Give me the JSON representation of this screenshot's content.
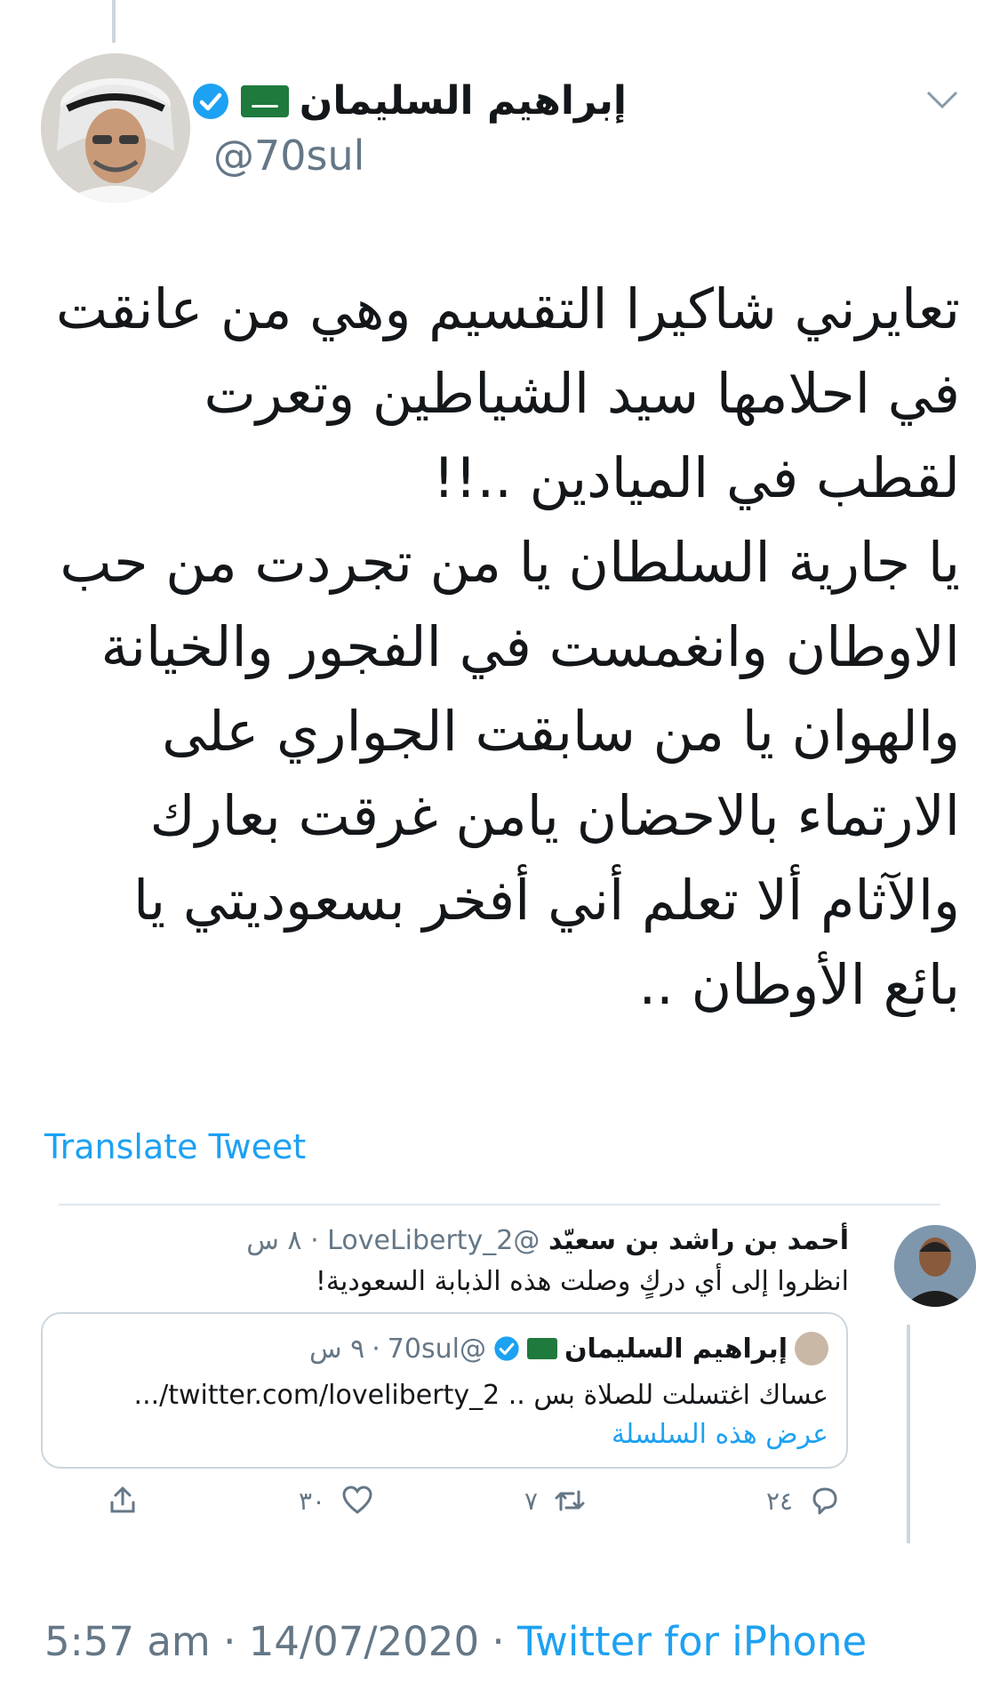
{
  "author": {
    "name": "إبراهيم السليمان",
    "handle": "@70sul"
  },
  "tweet": {
    "paragraphs": [
      "تعايرني شاكيرا التقسيم وهي من عانقت في احلامها سيد الشياطين وتعرت لقطب في الميادين ..!!",
      "يا جارية السلطان يا من تجردت من حب الاوطان وانغمست في الفجور والخيانة والهوان يا من سابقت الجواري على الارتماء بالاحضان يامن غرقت بعارك والآثام ألا تعلم أني أفخر بسعوديتي يا بائع الأوطان .."
    ],
    "translate_label": "Translate Tweet"
  },
  "reply": {
    "name": "أحمد بن راشد بن سعيّد",
    "handle": "@LoveLiberty_2",
    "time": "٨ س",
    "text": "انظروا إلى أي دركٍ وصلت هذه الذبابة السعودية!"
  },
  "quoted": {
    "name": "إبراهيم السليمان",
    "handle": "@70sul",
    "time": "٩ س",
    "text": "عساك اغتسلت للصلاة بس .. twitter.com/loveliberty_2/...",
    "thread_link": "عرض هذه السلسلة"
  },
  "actions": {
    "replies": "٢٤",
    "retweets": "٧",
    "likes": "٣٠"
  },
  "footer": {
    "time": "5:57 am",
    "date": "14/07/2020",
    "source": "Twitter for iPhone"
  },
  "colors": {
    "accent": "#1da1f2",
    "secondary_text": "#657786",
    "flag_green": "#1e7a3d"
  }
}
